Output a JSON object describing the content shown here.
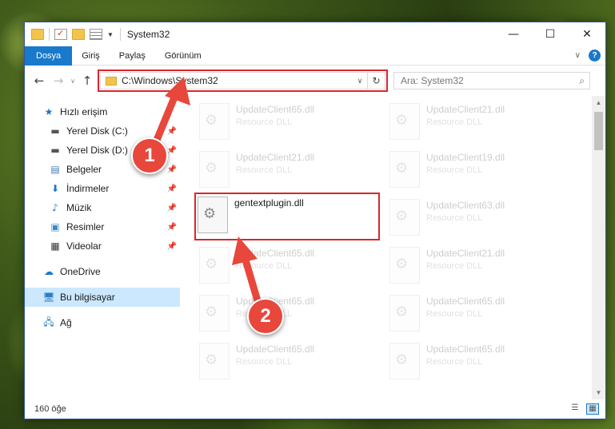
{
  "window": {
    "title": "System32"
  },
  "ribbon": {
    "tabs": [
      "Dosya",
      "Giriş",
      "Paylaş",
      "Görünüm"
    ]
  },
  "address": {
    "path": "C:\\Windows\\System32",
    "search_placeholder": "Ara: System32"
  },
  "nav": {
    "quick_access": "Hızlı erişim",
    "items": [
      {
        "label": "Yerel Disk (C:)",
        "icon": "drive-icon",
        "pinned": true
      },
      {
        "label": "Yerel Disk (D:)",
        "icon": "drive-icon",
        "pinned": true
      },
      {
        "label": "Belgeler",
        "icon": "documents-icon",
        "pinned": true
      },
      {
        "label": "İndirmeler",
        "icon": "download-icon",
        "pinned": true
      },
      {
        "label": "Müzik",
        "icon": "music-icon",
        "pinned": true
      },
      {
        "label": "Resimler",
        "icon": "pictures-icon",
        "pinned": true
      },
      {
        "label": "Videolar",
        "icon": "videos-icon",
        "pinned": true
      }
    ],
    "onedrive": "OneDrive",
    "this_pc": "Bu bilgisayar",
    "network": "Ağ"
  },
  "files": [
    {
      "name": "UpdateClient65.dll",
      "type": "Resource DLL"
    },
    {
      "name": "UpdateClient21.dll",
      "type": "Resource DLL"
    },
    {
      "name": "UpdateClient21.dll",
      "type": "Resource DLL"
    },
    {
      "name": "UpdateClient19.dll",
      "type": "Resource DLL"
    },
    {
      "name": "gentextplugin.dll",
      "type": "",
      "highlighted": true
    },
    {
      "name": "UpdateClient63.dll",
      "type": "Resource DLL"
    },
    {
      "name": "UpdateClient65.dll",
      "type": "Resource DLL"
    },
    {
      "name": "UpdateClient21.dll",
      "type": "Resource DLL"
    },
    {
      "name": "UpdateClient65.dll",
      "type": "Resource DLL"
    },
    {
      "name": "UpdateClient65.dll",
      "type": "Resource DLL"
    },
    {
      "name": "UpdateClient65.dll",
      "type": "Resource DLL"
    },
    {
      "name": "UpdateClient65.dll",
      "type": "Resource DLL"
    }
  ],
  "status": {
    "count": "160 öğe"
  },
  "annotations": {
    "step1": "1",
    "step2": "2",
    "accent": "#e8473c"
  }
}
